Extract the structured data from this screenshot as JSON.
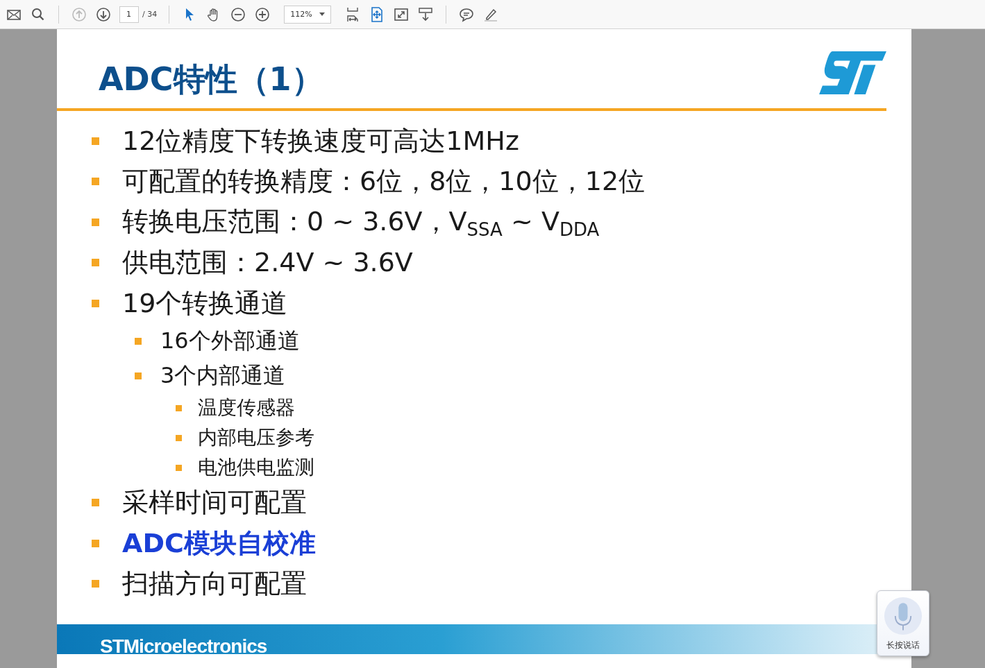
{
  "toolbar": {
    "page_number": "1",
    "page_count": "/ 34",
    "zoom": "112%"
  },
  "slide": {
    "title": "ADC特性（1）",
    "bullets": [
      {
        "text": "12位精度下转换速度可高达1MHz",
        "highlighted": false
      },
      {
        "text": "可配置的转换精度：6位，8位，10位，12位",
        "highlighted": false
      },
      {
        "text": "转换电压范围：0 ~ 3.6V，V$_{SSA}$ ~ V$_{DDA}$",
        "highlighted": false
      },
      {
        "text": "供电范围：2.4V ~ 3.6V",
        "highlighted": false
      },
      {
        "text": "19个转换通道",
        "highlighted": false,
        "children": [
          {
            "text": "16个外部通道"
          },
          {
            "text": "3个内部通道",
            "children": [
              {
                "text": "温度传感器"
              },
              {
                "text": "内部电压参考"
              },
              {
                "text": "电池供电监测"
              }
            ]
          }
        ]
      },
      {
        "text": "采样时间可配置",
        "highlighted": false
      },
      {
        "text": "ADC模块自校准",
        "highlighted": true
      },
      {
        "text": "扫描方向可配置",
        "highlighted": false
      }
    ],
    "footer_brand": "STMicroelectronics"
  },
  "voice_widget": {
    "label": "长按说话"
  }
}
